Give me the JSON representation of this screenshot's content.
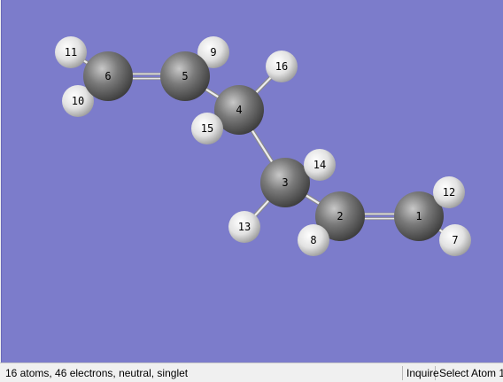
{
  "viewer": {
    "background": "#7c7ccb",
    "atom_color_carbon": "#747474",
    "atom_color_hydrogen": "#e8e8e8",
    "atoms": [
      {
        "label": "1",
        "element": "C"
      },
      {
        "label": "2",
        "element": "C"
      },
      {
        "label": "3",
        "element": "C"
      },
      {
        "label": "4",
        "element": "C"
      },
      {
        "label": "5",
        "element": "C"
      },
      {
        "label": "6",
        "element": "C"
      },
      {
        "label": "7",
        "element": "H"
      },
      {
        "label": "8",
        "element": "H"
      },
      {
        "label": "9",
        "element": "H"
      },
      {
        "label": "10",
        "element": "H"
      },
      {
        "label": "11",
        "element": "H"
      },
      {
        "label": "12",
        "element": "H"
      },
      {
        "label": "13",
        "element": "H"
      },
      {
        "label": "14",
        "element": "H"
      },
      {
        "label": "15",
        "element": "H"
      },
      {
        "label": "16",
        "element": "H"
      }
    ],
    "bonds": [
      {
        "a": "1",
        "b": "2",
        "order": 2
      },
      {
        "a": "2",
        "b": "3",
        "order": 1
      },
      {
        "a": "3",
        "b": "4",
        "order": 1
      },
      {
        "a": "4",
        "b": "5",
        "order": 1
      },
      {
        "a": "5",
        "b": "6",
        "order": 2
      },
      {
        "a": "1",
        "b": "7",
        "order": 1
      },
      {
        "a": "1",
        "b": "12",
        "order": 1
      },
      {
        "a": "2",
        "b": "8",
        "order": 1
      },
      {
        "a": "3",
        "b": "13",
        "order": 1
      },
      {
        "a": "3",
        "b": "14",
        "order": 1
      },
      {
        "a": "4",
        "b": "15",
        "order": 1
      },
      {
        "a": "4",
        "b": "16",
        "order": 1
      },
      {
        "a": "5",
        "b": "9",
        "order": 1
      },
      {
        "a": "6",
        "b": "10",
        "order": 1
      },
      {
        "a": "6",
        "b": "11",
        "order": 1
      }
    ]
  },
  "statusbar": {
    "info": "16 atoms, 46 electrons, neutral, singlet",
    "mode": "Inquire",
    "action": "Select Atom 1"
  }
}
